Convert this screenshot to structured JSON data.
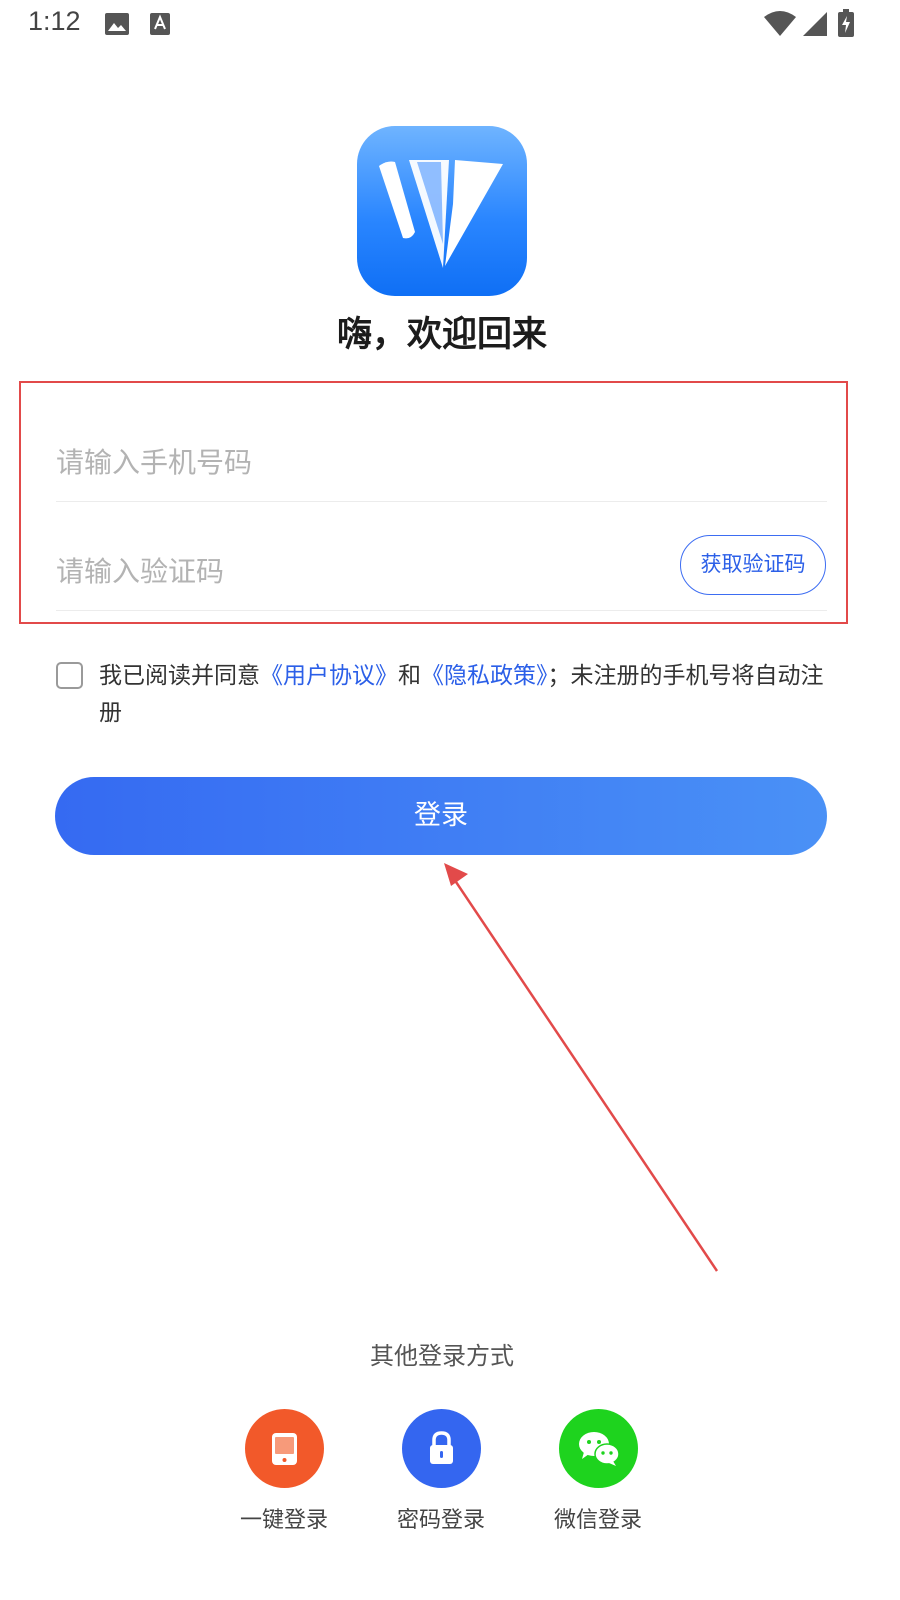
{
  "status_bar": {
    "time": "1:12",
    "icons": [
      "image-icon",
      "text-a-icon",
      "wifi-icon",
      "signal-icon",
      "battery-charging-icon"
    ]
  },
  "app": {
    "logo_icon": "app-logo-v-icon",
    "welcome_title": "嗨，欢迎回来"
  },
  "form": {
    "phone_placeholder": "请输入手机号码",
    "phone_value": "",
    "code_placeholder": "请输入验证码",
    "code_value": "",
    "get_code_label": "获取验证码"
  },
  "agreement": {
    "checked": false,
    "prefix": "我已阅读并同意",
    "user_agreement": "《用户协议》",
    "and": "和",
    "privacy_policy": "《隐私政策》",
    "suffix": "；未注册的手机号将自动注册"
  },
  "login_button_label": "登录",
  "other_login": {
    "title": "其他登录方式",
    "methods": [
      {
        "label": "一键登录",
        "icon": "phone-icon",
        "color": "#f2592a"
      },
      {
        "label": "密码登录",
        "icon": "lock-icon",
        "color": "#3466f0"
      },
      {
        "label": "微信登录",
        "icon": "wechat-icon",
        "color": "#1ed31e"
      }
    ]
  },
  "colors": {
    "accent": "#356af2",
    "link": "#2b5fe8",
    "annotation": "#e24a4a"
  }
}
